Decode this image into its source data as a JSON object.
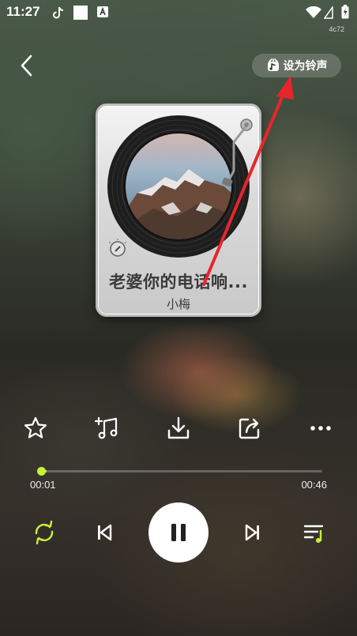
{
  "status_bar": {
    "time": "11:27",
    "device_code": "4c72"
  },
  "header": {
    "set_ringtone_label": "设为铃声"
  },
  "song": {
    "title": "老婆你的电话响...",
    "artist": "小梅"
  },
  "actions": [
    {
      "name": "favorite-button",
      "icon": "star-icon"
    },
    {
      "name": "add-to-playlist-button",
      "icon": "music-add-icon"
    },
    {
      "name": "download-button",
      "icon": "download-icon"
    },
    {
      "name": "share-button",
      "icon": "share-icon"
    },
    {
      "name": "more-button",
      "icon": "more-icon"
    }
  ],
  "progress": {
    "elapsed": "00:01",
    "duration": "00:46",
    "fraction": 0.02
  },
  "colors": {
    "accent": "#c8f03a",
    "annotation_arrow": "#e8252b"
  }
}
